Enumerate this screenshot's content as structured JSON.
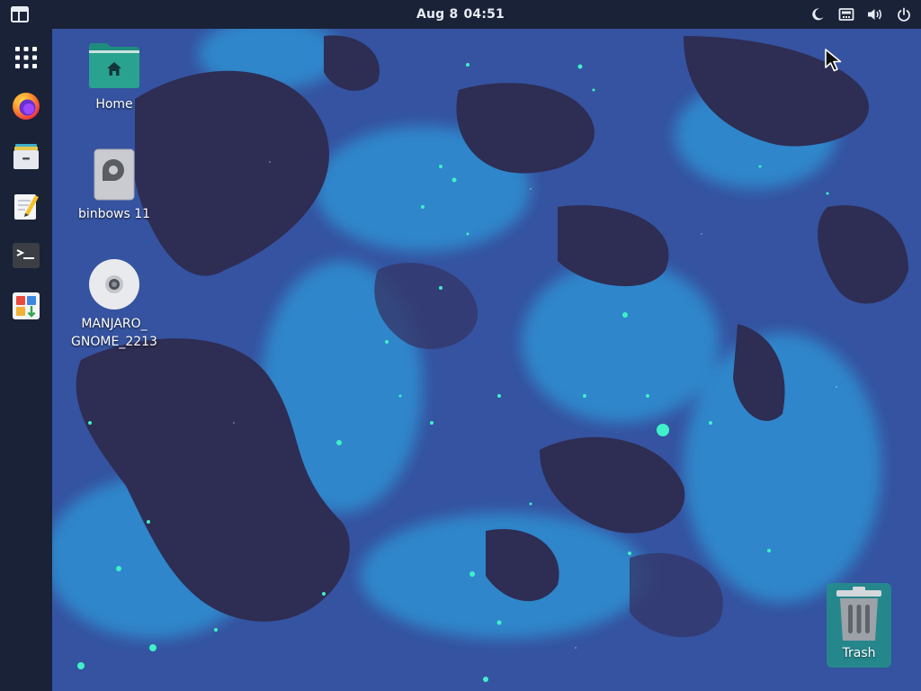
{
  "topbar": {
    "date": "Aug 8",
    "time": "04:51",
    "tray": [
      {
        "icon": "night-light-icon"
      },
      {
        "icon": "network-icon"
      },
      {
        "icon": "volume-icon"
      },
      {
        "icon": "power-icon"
      }
    ]
  },
  "dock": {
    "items": [
      {
        "icon": "app-grid-icon"
      },
      {
        "icon": "firefox-icon"
      },
      {
        "icon": "file-manager-icon"
      },
      {
        "icon": "text-editor-icon"
      },
      {
        "icon": "terminal-icon"
      },
      {
        "icon": "software-center-icon"
      }
    ]
  },
  "desktop": {
    "icons": [
      {
        "label": "Home",
        "icon": "home-folder-icon"
      },
      {
        "label": "binbows 11",
        "icon": "drive-icon"
      },
      {
        "label": "MANJARO_\nGNOME_2213",
        "icon": "optical-disc-icon"
      }
    ],
    "trash": {
      "label": "Trash",
      "icon": "trash-icon"
    }
  },
  "colors": {
    "panel": "#1a2237",
    "accent_teal": "#229088",
    "wallpaper_dark": "#2c2f55",
    "wallpaper_mid": "#3a5aa8",
    "wallpaper_bright": "#2e8fd0",
    "sparkle": "#3ff0c8"
  }
}
